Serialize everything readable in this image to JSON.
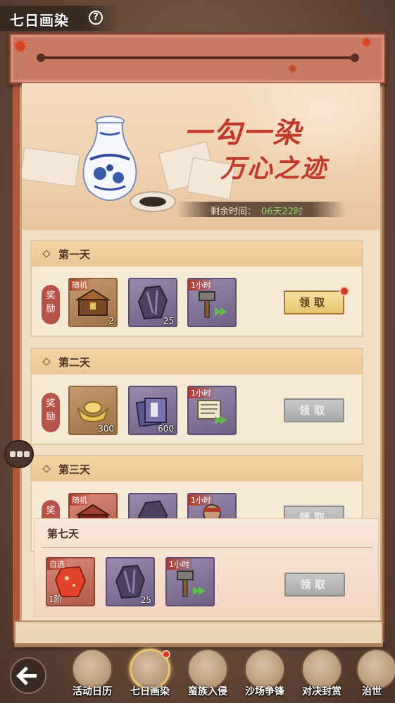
{
  "header": {
    "title": "七日画染",
    "help_icon": "question-circle-icon"
  },
  "banner": {
    "slogan_line1": "一勾一染",
    "slogan_line2": "万心之迹",
    "remaining_label": "剩余时间：",
    "remaining_value": "06天22时"
  },
  "reward_tag": "奖励",
  "days": [
    {
      "label": "第一天",
      "button": "领取",
      "button_state": "active",
      "has_red_dot": true,
      "items": [
        {
          "icon": "treasure-chest-icon",
          "frame": "brown",
          "corner": "随机",
          "count": "2"
        },
        {
          "icon": "crystal-ore-icon",
          "frame": "purple",
          "corner": "",
          "count": "25"
        },
        {
          "icon": "hammer-speedup-icon",
          "frame": "purple",
          "corner": "1小时",
          "count": ""
        }
      ]
    },
    {
      "label": "第二天",
      "button": "领取",
      "button_state": "disabled",
      "has_red_dot": false,
      "items": [
        {
          "icon": "gold-ingot-icon",
          "frame": "brown",
          "corner": "",
          "count": "300"
        },
        {
          "icon": "book-stack-icon",
          "frame": "purple",
          "corner": "",
          "count": "600"
        },
        {
          "icon": "scroll-speedup-icon",
          "frame": "purple",
          "corner": "1小时",
          "count": ""
        }
      ]
    },
    {
      "label": "第三天",
      "button": "领取",
      "button_state": "disabled",
      "has_red_dot": false,
      "items": [
        {
          "icon": "treasure-chest-icon",
          "frame": "red",
          "corner": "随机",
          "count": ""
        },
        {
          "icon": "crystal-ore-icon",
          "frame": "purple",
          "corner": "",
          "count": ""
        },
        {
          "icon": "warrior-speedup-icon",
          "frame": "purple",
          "corner": "1小时",
          "count": ""
        }
      ]
    }
  ],
  "day7": {
    "label": "第七天",
    "button": "领取",
    "items": [
      {
        "icon": "red-gem-icon",
        "frame": "red",
        "corner": "自选",
        "count": "",
        "bottom_left": "1阶"
      },
      {
        "icon": "crystal-ore-icon",
        "frame": "purple",
        "corner": "",
        "count": "25"
      },
      {
        "icon": "hammer-speedup-icon",
        "frame": "purple",
        "corner": "1小时",
        "count": ""
      }
    ]
  },
  "bottom_nav": {
    "back_icon": "back-arrow-icon",
    "items": [
      {
        "label": "活动日历",
        "icon": "calendar-icon",
        "active": false
      },
      {
        "label": "七日画染",
        "icon": "scroll-painting-icon",
        "active": true
      },
      {
        "label": "蛮族入侵",
        "icon": "barbarian-icon",
        "active": false
      },
      {
        "label": "沙场争锋",
        "icon": "cavalry-icon",
        "active": false
      },
      {
        "label": "对决封赏",
        "icon": "duel-scroll-icon",
        "active": false
      },
      {
        "label": "治世",
        "icon": "governance-icon",
        "active": false
      }
    ]
  },
  "colors": {
    "accent_red": "#c0392b",
    "timer_green": "#8ed06a",
    "active_button": "#e7c46b"
  }
}
